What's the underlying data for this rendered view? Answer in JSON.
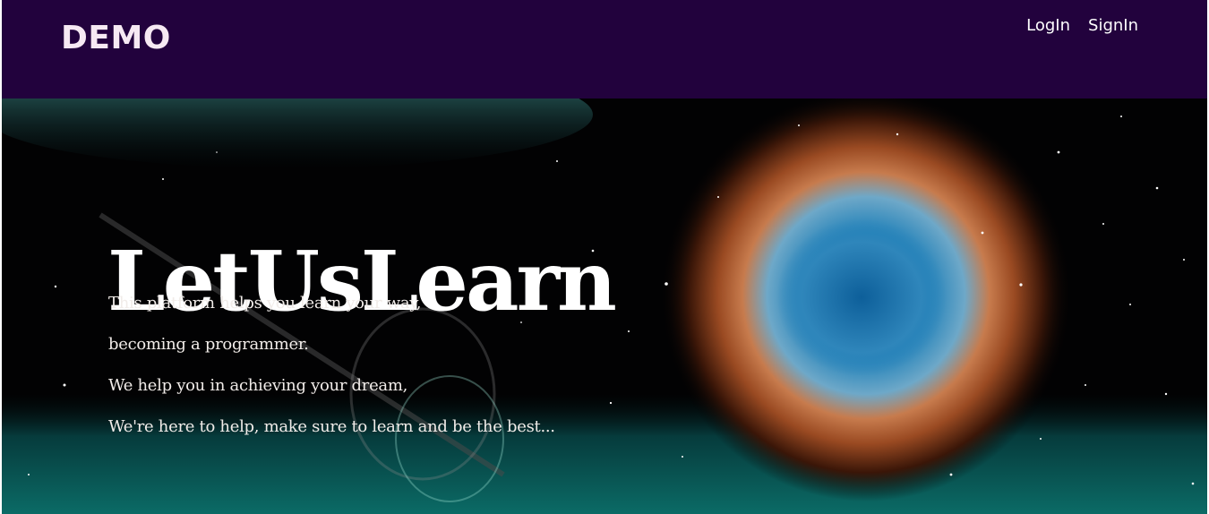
{
  "header": {
    "brand": "DEMO",
    "nav": {
      "login_label": "LogIn",
      "signin_label": "SignIn"
    }
  },
  "hero": {
    "title": "LetUsLearn",
    "lines": [
      "This platform helps you learn your way,",
      "becoming a programmer.",
      "We help you in achieving your dream,",
      "We're here to help, make sure to learn and be the best..."
    ],
    "background": "space-nebula-eye-image"
  },
  "colors": {
    "header_bg": "#22023d",
    "brand_text": "#f6e9f3",
    "nav_text": "#ffffff",
    "hero_text": "#ffffff"
  }
}
